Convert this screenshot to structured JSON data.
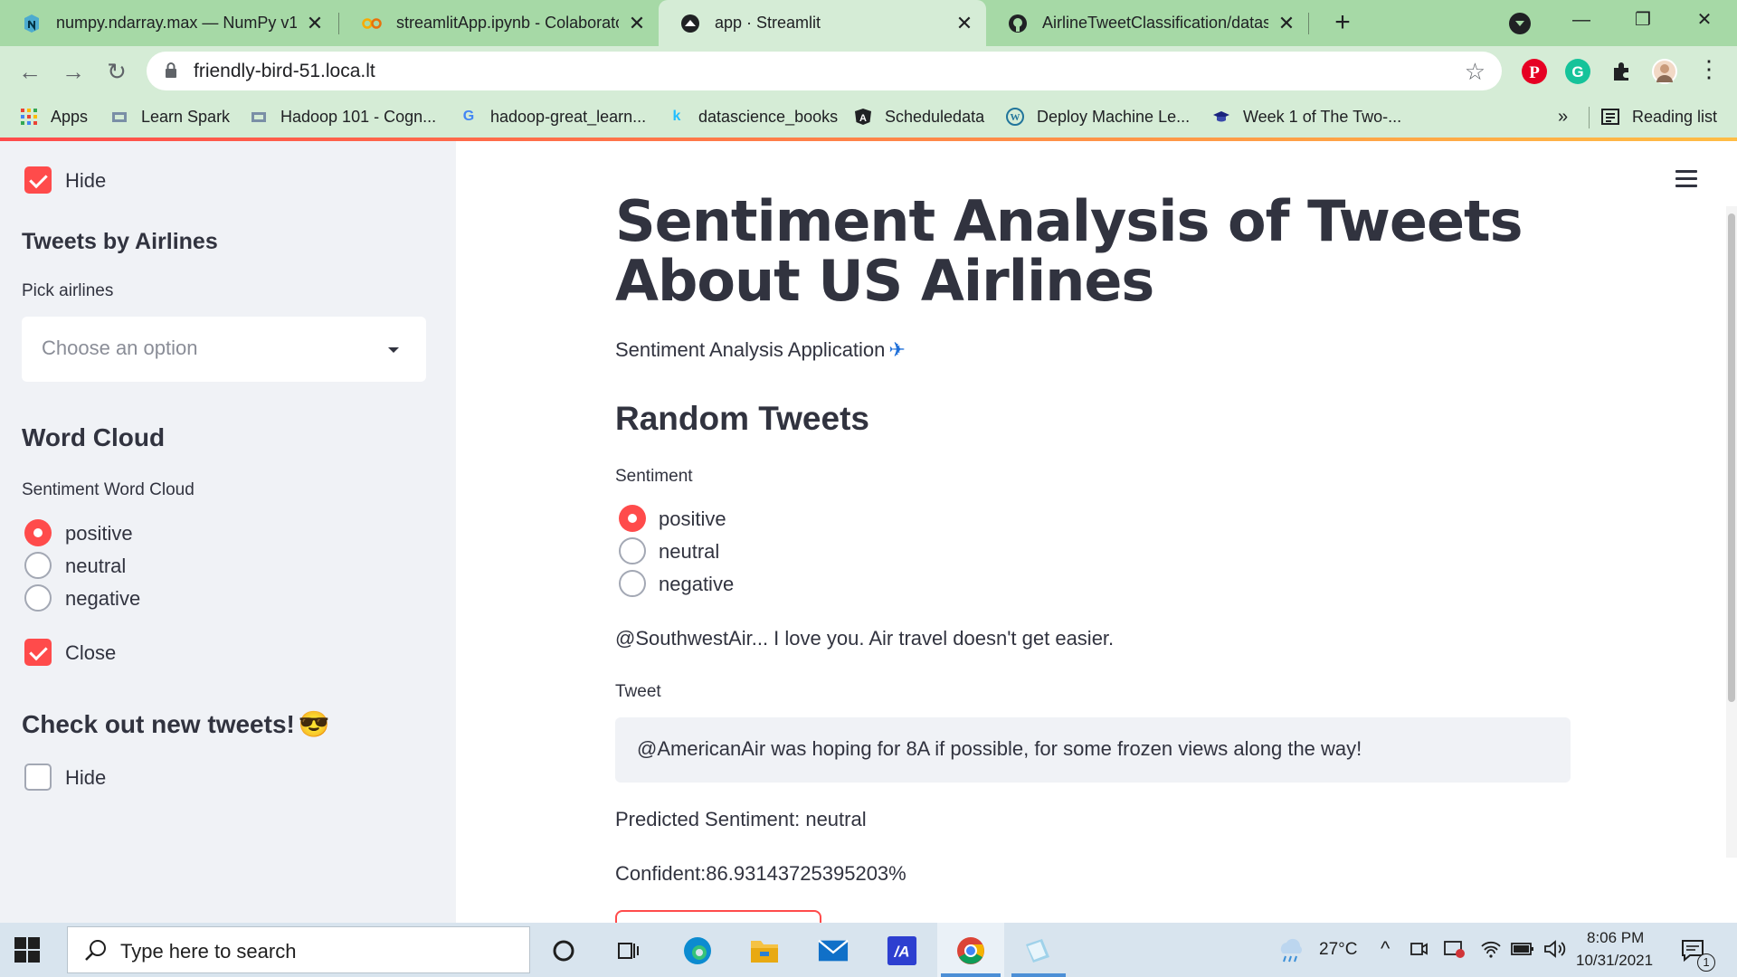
{
  "browser": {
    "tabs": [
      {
        "title": "numpy.ndarray.max — NumPy v1",
        "icon": "numpy-icon",
        "active": false
      },
      {
        "title": "streamlitApp.ipynb - Colaboratory",
        "icon": "colab-icon",
        "active": false
      },
      {
        "title": "app · Streamlit",
        "icon": "streamlit-icon",
        "active": true
      },
      {
        "title": "AirlineTweetClassification/dataset",
        "icon": "github-icon",
        "active": false
      }
    ],
    "url": "friendly-bird-51.loca.lt",
    "bookmarks": [
      {
        "label": "Apps",
        "icon": "apps-grid-icon"
      },
      {
        "label": "Learn Spark",
        "icon": "bookmark-site-icon"
      },
      {
        "label": "Hadoop 101 - Cogn...",
        "icon": "bookmark-site-icon"
      },
      {
        "label": "hadoop-great_learn...",
        "icon": "google-icon"
      },
      {
        "label": "datascience_books",
        "icon": "kaggle-icon"
      },
      {
        "label": "Scheduledata",
        "icon": "angular-icon"
      },
      {
        "label": "Deploy Machine Le...",
        "icon": "wordpress-icon"
      },
      {
        "label": "Week 1 of The Two-...",
        "icon": "graduation-cap-icon"
      }
    ],
    "bookmarks_overflow": "»",
    "reading_list": "Reading list",
    "colors": {
      "frame": "#a6d9a6",
      "toolbar": "#d5ecd6"
    }
  },
  "sidebar": {
    "hide_checkbox": {
      "label": "Hide",
      "checked": true
    },
    "tweets_by_airlines": {
      "heading": "Tweets by Airlines",
      "select_label": "Pick airlines",
      "select_placeholder": "Choose an option"
    },
    "word_cloud": {
      "heading": "Word Cloud",
      "radio_label": "Sentiment Word Cloud",
      "options": [
        "positive",
        "neutral",
        "negative"
      ],
      "selected": "positive",
      "close_checkbox": {
        "label": "Close",
        "checked": true
      }
    },
    "new_tweets": {
      "heading": "Check out new tweets!",
      "emoji": "😎",
      "hide_checkbox": {
        "label": "Hide",
        "checked": false
      }
    }
  },
  "main": {
    "title": "Sentiment Analysis of Tweets About US Airlines",
    "subtitle": "Sentiment Analysis Application",
    "subtitle_emoji": "✈",
    "random_tweets": {
      "heading": "Random Tweets",
      "radio_label": "Sentiment",
      "options": [
        "positive",
        "neutral",
        "negative"
      ],
      "selected": "positive",
      "sample_tweet": "@SouthwestAir... I love you. Air travel doesn't get easier."
    },
    "tweet_input": {
      "label": "Tweet",
      "value": "@AmericanAir was hoping for 8A if possible, for some frozen views along the way!"
    },
    "prediction": "Predicted Sentiment: neutral",
    "confidence": "Confident:86.93143725395203%",
    "colors": {
      "accent": "#ff4b4b",
      "text": "#31333f",
      "sidebar_bg": "#f0f2f6"
    }
  },
  "taskbar": {
    "search_placeholder": "Type here to search",
    "apps": [
      "cortana-icon",
      "task-view-icon",
      "edge-icon",
      "file-explorer-icon",
      "mail-icon",
      "powerapps-icon",
      "chrome-icon",
      "notepad-icon"
    ],
    "weather": "27°C",
    "time": "8:06 PM",
    "date": "10/31/2021",
    "notification_count": "1"
  }
}
